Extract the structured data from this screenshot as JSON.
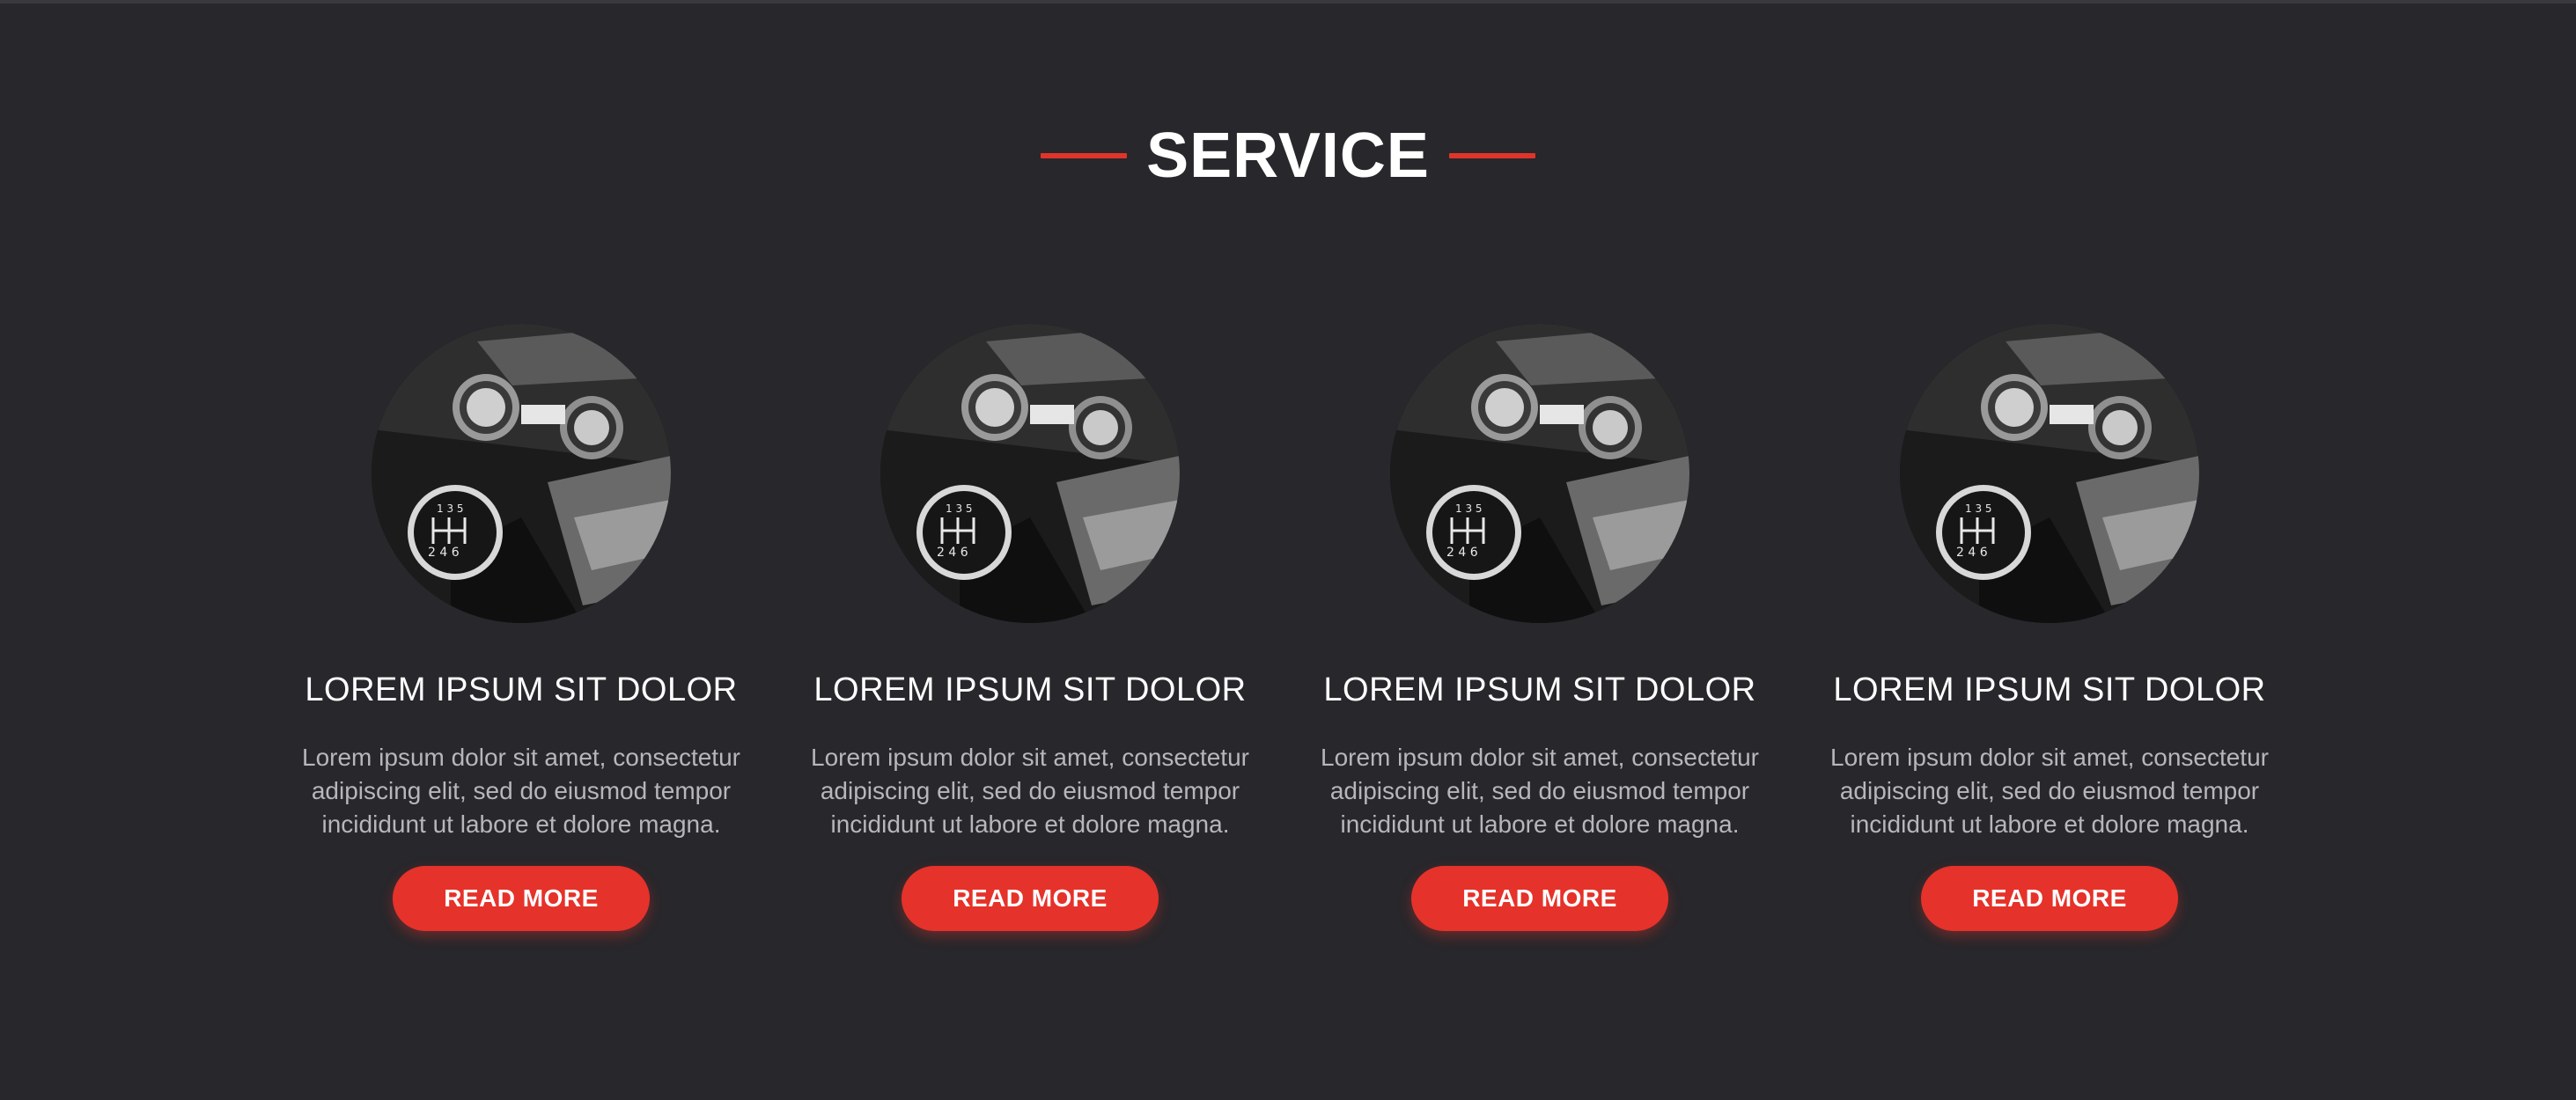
{
  "section": {
    "title": "SERVICE",
    "accent_color": "#e5322a",
    "background_color": "#28272b"
  },
  "cards": [
    {
      "image_icon": "gear-shift-photo",
      "title": "LOREM IPSUM SIT DOLOR",
      "text": "Lorem ipsum dolor sit amet, consectetur adipiscing elit, sed do eiusmod tempor incididunt ut labore et dolore magna.",
      "button_label": "READ MORE"
    },
    {
      "image_icon": "gear-shift-photo",
      "title": "LOREM IPSUM SIT DOLOR",
      "text": "Lorem ipsum dolor sit amet, consectetur adipiscing elit, sed do eiusmod tempor incididunt ut labore et dolore magna.",
      "button_label": "READ MORE"
    },
    {
      "image_icon": "gear-shift-photo",
      "title": "LOREM IPSUM SIT DOLOR",
      "text": "Lorem ipsum dolor sit amet, consectetur adipiscing elit, sed do eiusmod tempor incididunt ut labore et dolore magna.",
      "button_label": "READ MORE"
    },
    {
      "image_icon": "gear-shift-photo",
      "title": "LOREM IPSUM SIT DOLOR",
      "text": "Lorem ipsum dolor sit amet, consectetur adipiscing elit, sed do eiusmod tempor incididunt ut labore et dolore magna.",
      "button_label": "READ MORE"
    }
  ]
}
